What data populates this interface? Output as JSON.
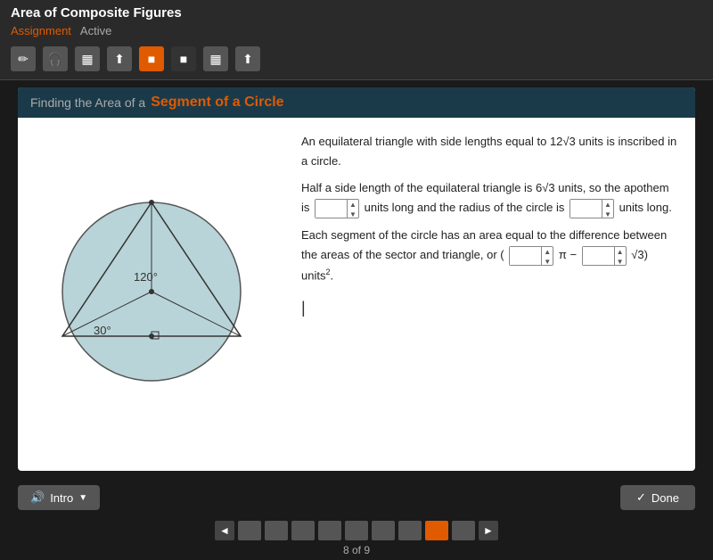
{
  "header": {
    "title": "Area of Composite Figures",
    "assignment_label": "Assignment",
    "active_label": "Active"
  },
  "toolbar": {
    "buttons": [
      "✏",
      "🎧",
      "▦",
      "⬆",
      "■",
      "■",
      "▦",
      "⬆"
    ]
  },
  "section": {
    "title_prefix": "Finding the Area of a ",
    "title_main": "Segment of a Circle"
  },
  "problem": {
    "line1": "An equilateral triangle with side lengths equal to 12√3",
    "line2": "units is inscribed in a circle.",
    "line3_pre": "Half a side length of the equilateral triangle is 6√3",
    "line4_pre": "units, so the apothem is",
    "line4_mid": "units long and the",
    "line5_pre": "radius of the circle is",
    "line5_end": "units long.",
    "line6": "Each segment of the circle has an area equal to the",
    "line7": "difference between the areas of the sector and triangle,",
    "line8_pre": "or (",
    "line8_pi": "π −",
    "line8_sqrt": "√3) units²."
  },
  "bottom": {
    "intro_label": "Intro",
    "done_label": "Done",
    "page_indicator": "8 of 9"
  },
  "nav": {
    "total_boxes": 9,
    "active_box": 8
  },
  "angles": {
    "central": "120°",
    "base": "30°"
  }
}
